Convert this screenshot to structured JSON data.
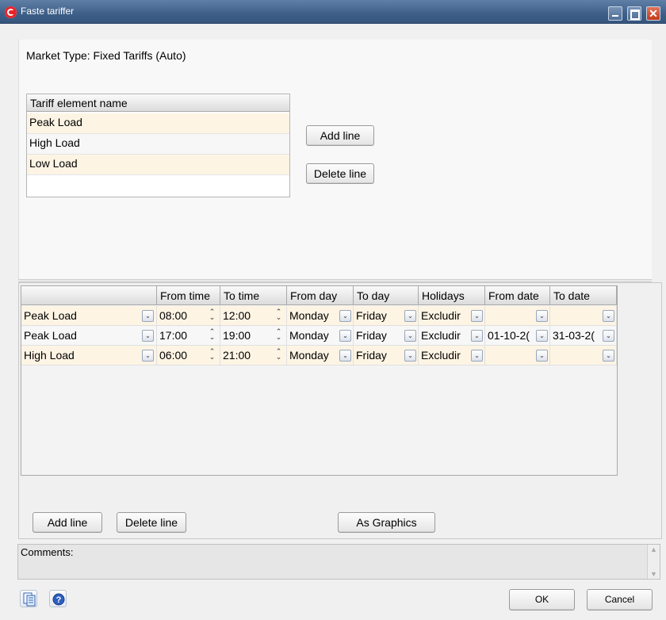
{
  "window": {
    "title": "Faste tariffer"
  },
  "market_type": "Market Type: Fixed Tariffs (Auto)",
  "tariff_table": {
    "header": "Tariff element name",
    "rows": [
      "Peak Load",
      "High Load",
      "Low Load"
    ]
  },
  "top_buttons": {
    "add_line": "Add line",
    "delete_line": "Delete line"
  },
  "grid": {
    "columns": [
      "",
      "From time",
      "To time",
      "From day",
      "To day",
      "Holidays",
      "From date",
      "To date"
    ],
    "rows": [
      {
        "element": "Peak Load",
        "from_time": "08:00",
        "to_time": "12:00",
        "from_day": "Monday",
        "to_day": "Friday",
        "holidays": "Excludir",
        "from_date": "",
        "to_date": ""
      },
      {
        "element": "Peak Load",
        "from_time": "17:00",
        "to_time": "19:00",
        "from_day": "Monday",
        "to_day": "Friday",
        "holidays": "Excludir",
        "from_date": "01-10-2(",
        "to_date": "31-03-2("
      },
      {
        "element": "High Load",
        "from_time": "06:00",
        "to_time": "21:00",
        "from_day": "Monday",
        "to_day": "Friday",
        "holidays": "Excludir",
        "from_date": "",
        "to_date": ""
      }
    ]
  },
  "bottom_buttons": {
    "add_line": "Add line",
    "delete_line": "Delete line",
    "as_graphics": "As Graphics"
  },
  "comments": {
    "label": "Comments:",
    "value": ""
  },
  "footer": {
    "ok": "OK",
    "cancel": "Cancel"
  },
  "icons": {
    "app": "app-logo-icon",
    "copy": "copy-icon",
    "help": "help-icon"
  },
  "colors": {
    "titlebar": "#3e5f88",
    "row_highlight": "#fdf4e4",
    "close": "#c33a1a"
  }
}
